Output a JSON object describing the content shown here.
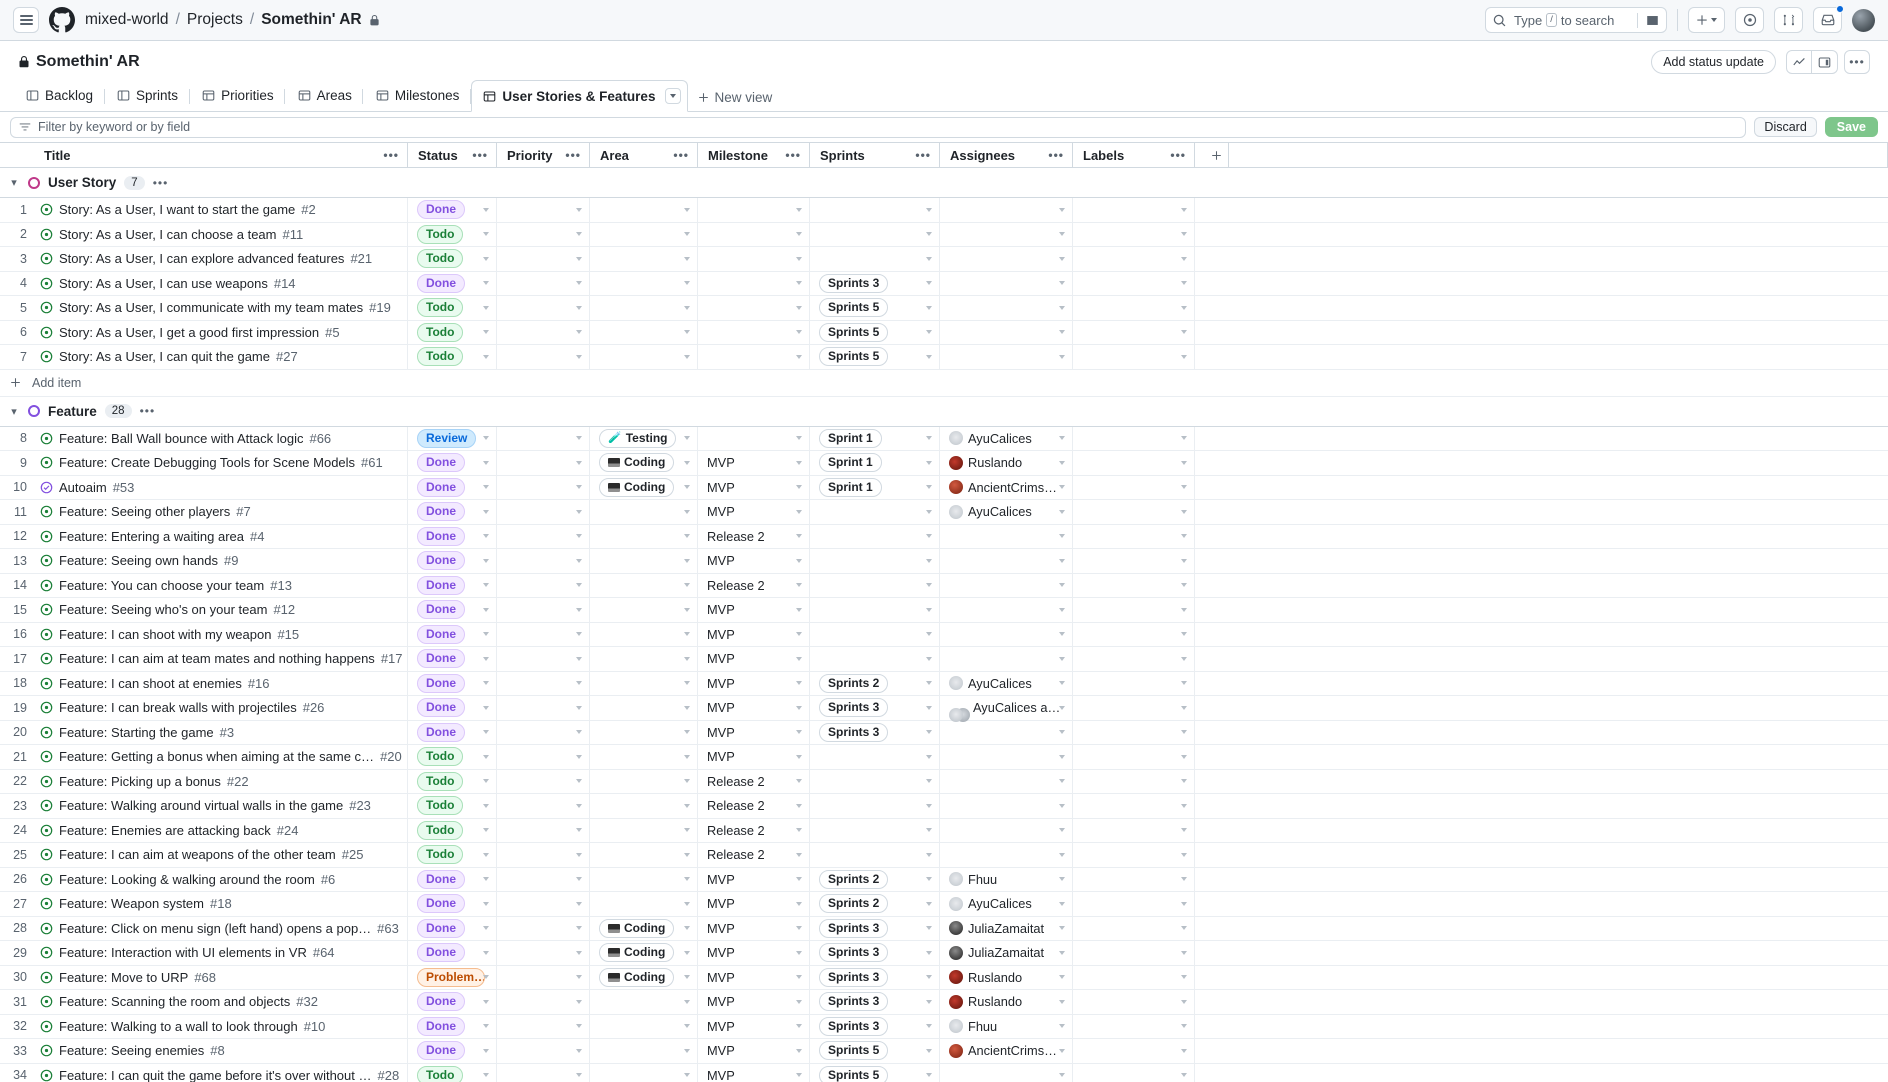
{
  "header": {
    "breadcrumb": {
      "owner": "mixed-world",
      "section": "Projects",
      "project": "Somethin' AR",
      "sep": "/"
    },
    "search": {
      "prefix": "Type",
      "key": "/",
      "suffix": "to search"
    },
    "icons": {
      "hamburger": "hamburger-icon",
      "logo": "github-logo-icon",
      "search": "search-icon",
      "terminal": "command-palette-icon",
      "plus": "plus-icon",
      "issues": "issues-icon",
      "pullrequests": "pull-requests-icon",
      "inbox": "notifications-inbox-icon",
      "avatar": "user-avatar"
    }
  },
  "project": {
    "name": "Somethin' AR",
    "visibility_icon": "lock-icon",
    "add_status_update": "Add status update",
    "insights_icon": "insights-chart-icon",
    "sidepanel_icon": "side-panel-icon",
    "more_icon": "more-options-icon"
  },
  "tabs": [
    {
      "label": "Backlog",
      "icon": "table-board-icon",
      "active": false
    },
    {
      "label": "Sprints",
      "icon": "table-board-icon",
      "active": false
    },
    {
      "label": "Priorities",
      "icon": "table-view-icon",
      "active": false
    },
    {
      "label": "Areas",
      "icon": "table-view-icon",
      "active": false
    },
    {
      "label": "Milestones",
      "icon": "table-view-icon",
      "active": false
    },
    {
      "label": "User Stories & Features",
      "icon": "table-view-icon",
      "active": true
    }
  ],
  "new_view": "New view",
  "filter": {
    "placeholder": "Filter by keyword or by field",
    "icon": "filter-icon",
    "discard_label": "Discard",
    "save_label": "Save"
  },
  "columns": [
    {
      "key": "title",
      "label": "Title"
    },
    {
      "key": "status",
      "label": "Status"
    },
    {
      "key": "priority",
      "label": "Priority"
    },
    {
      "key": "area",
      "label": "Area"
    },
    {
      "key": "milestone",
      "label": "Milestone"
    },
    {
      "key": "sprints",
      "label": "Sprints"
    },
    {
      "key": "assignees",
      "label": "Assignees"
    },
    {
      "key": "labels",
      "label": "Labels"
    }
  ],
  "add_column_label": "+",
  "groups": [
    {
      "name": "User Story",
      "count": "7",
      "color": "#bf3989",
      "add_item_label": "Add item",
      "rows": [
        {
          "n": "1",
          "title": "Story: As a User, I want to start the game",
          "num": "#2",
          "status": "Done",
          "status_kind": "done",
          "priority": "",
          "area": "",
          "area_kind": "",
          "milestone": "",
          "sprints": "",
          "assignee": "",
          "assignee_kind": "",
          "labels": ""
        },
        {
          "n": "2",
          "title": "Story: As a User, I can choose a team",
          "num": "#11",
          "status": "Todo",
          "status_kind": "todo",
          "priority": "",
          "area": "",
          "area_kind": "",
          "milestone": "",
          "sprints": "",
          "assignee": "",
          "assignee_kind": "",
          "labels": ""
        },
        {
          "n": "3",
          "title": "Story: As a User, I can explore advanced features",
          "num": "#21",
          "status": "Todo",
          "status_kind": "todo",
          "priority": "",
          "area": "",
          "area_kind": "",
          "milestone": "",
          "sprints": "",
          "assignee": "",
          "assignee_kind": "",
          "labels": ""
        },
        {
          "n": "4",
          "title": "Story: As a User, I can use weapons",
          "num": "#14",
          "status": "Done",
          "status_kind": "done",
          "priority": "",
          "area": "",
          "area_kind": "",
          "milestone": "",
          "sprints": "Sprints 3",
          "assignee": "",
          "assignee_kind": "",
          "labels": ""
        },
        {
          "n": "5",
          "title": "Story: As a User, I communicate with my team mates",
          "num": "#19",
          "status": "Todo",
          "status_kind": "todo",
          "priority": "",
          "area": "",
          "area_kind": "",
          "milestone": "",
          "sprints": "Sprints 5",
          "assignee": "",
          "assignee_kind": "",
          "labels": ""
        },
        {
          "n": "6",
          "title": "Story: As a User, I get a good first impression",
          "num": "#5",
          "status": "Todo",
          "status_kind": "todo",
          "priority": "",
          "area": "",
          "area_kind": "",
          "milestone": "",
          "sprints": "Sprints 5",
          "assignee": "",
          "assignee_kind": "",
          "labels": ""
        },
        {
          "n": "7",
          "title": "Story: As a User, I can quit the game",
          "num": "#27",
          "status": "Todo",
          "status_kind": "todo",
          "priority": "",
          "area": "",
          "area_kind": "",
          "milestone": "",
          "sprints": "Sprints 5",
          "assignee": "",
          "assignee_kind": "",
          "labels": ""
        }
      ]
    },
    {
      "name": "Feature",
      "count": "28",
      "color": "#8250df",
      "add_item_label": "",
      "rows": [
        {
          "n": "8",
          "title": "Feature: Ball Wall bounce with Attack logic",
          "num": "#66",
          "status": "Review",
          "status_kind": "review",
          "priority": "",
          "area": "Testing",
          "area_kind": "testing",
          "milestone": "",
          "sprints": "Sprint 1",
          "assignee": "AyuCalices",
          "assignee_kind": "ayu",
          "labels": ""
        },
        {
          "n": "9",
          "title": "Feature: Create Debugging Tools for Scene Models",
          "num": "#61",
          "status": "Done",
          "status_kind": "done",
          "priority": "",
          "area": "Coding",
          "area_kind": "coding",
          "milestone": "MVP",
          "sprints": "Sprint 1",
          "assignee": "Ruslando",
          "assignee_kind": "rus",
          "labels": ""
        },
        {
          "n": "10",
          "title": "Autoaim",
          "num": "#53",
          "status": "Done",
          "status_kind": "done",
          "priority": "",
          "area": "Coding",
          "area_kind": "coding",
          "milestone": "MVP",
          "sprints": "Sprint 1",
          "assignee": "AncientCrims…",
          "assignee_kind": "anc",
          "labels": ""
        },
        {
          "n": "11",
          "title": "Feature: Seeing other players",
          "num": "#7",
          "status": "Done",
          "status_kind": "done",
          "priority": "",
          "area": "",
          "area_kind": "",
          "milestone": "MVP",
          "sprints": "",
          "assignee": "AyuCalices",
          "assignee_kind": "ayu",
          "labels": ""
        },
        {
          "n": "12",
          "title": "Feature: Entering a waiting area",
          "num": "#4",
          "status": "Done",
          "status_kind": "done",
          "priority": "",
          "area": "",
          "area_kind": "",
          "milestone": "Release 2",
          "sprints": "",
          "assignee": "",
          "assignee_kind": "",
          "labels": ""
        },
        {
          "n": "13",
          "title": "Feature: Seeing own hands",
          "num": "#9",
          "status": "Done",
          "status_kind": "done",
          "priority": "",
          "area": "",
          "area_kind": "",
          "milestone": "MVP",
          "sprints": "",
          "assignee": "",
          "assignee_kind": "",
          "labels": ""
        },
        {
          "n": "14",
          "title": "Feature: You can choose your team",
          "num": "#13",
          "status": "Done",
          "status_kind": "done",
          "priority": "",
          "area": "",
          "area_kind": "",
          "milestone": "Release 2",
          "sprints": "",
          "assignee": "",
          "assignee_kind": "",
          "labels": ""
        },
        {
          "n": "15",
          "title": "Feature: Seeing who's on your team",
          "num": "#12",
          "status": "Done",
          "status_kind": "done",
          "priority": "",
          "area": "",
          "area_kind": "",
          "milestone": "MVP",
          "sprints": "",
          "assignee": "",
          "assignee_kind": "",
          "labels": ""
        },
        {
          "n": "16",
          "title": "Feature: I can shoot with my weapon",
          "num": "#15",
          "status": "Done",
          "status_kind": "done",
          "priority": "",
          "area": "",
          "area_kind": "",
          "milestone": "MVP",
          "sprints": "",
          "assignee": "",
          "assignee_kind": "",
          "labels": ""
        },
        {
          "n": "17",
          "title": "Feature: I can aim at team mates and nothing happens",
          "num": "#17",
          "status": "Done",
          "status_kind": "done",
          "priority": "",
          "area": "",
          "area_kind": "",
          "milestone": "MVP",
          "sprints": "",
          "assignee": "",
          "assignee_kind": "",
          "labels": ""
        },
        {
          "n": "18",
          "title": "Feature: I can shoot at enemies",
          "num": "#16",
          "status": "Done",
          "status_kind": "done",
          "priority": "",
          "area": "",
          "area_kind": "",
          "milestone": "MVP",
          "sprints": "Sprints 2",
          "assignee": "AyuCalices",
          "assignee_kind": "ayu",
          "labels": ""
        },
        {
          "n": "19",
          "title": "Feature: I can break walls with projectiles",
          "num": "#26",
          "status": "Done",
          "status_kind": "done",
          "priority": "",
          "area": "",
          "area_kind": "",
          "milestone": "MVP",
          "sprints": "Sprints 3",
          "assignee": "AyuCalices a…",
          "assignee_kind": "double",
          "labels": ""
        },
        {
          "n": "20",
          "title": "Feature: Starting the game",
          "num": "#3",
          "status": "Done",
          "status_kind": "done",
          "priority": "",
          "area": "",
          "area_kind": "",
          "milestone": "MVP",
          "sprints": "Sprints 3",
          "assignee": "",
          "assignee_kind": "",
          "labels": ""
        },
        {
          "n": "21",
          "title": "Feature: Getting a bonus when aiming at the same c…",
          "num": "#20",
          "status": "Todo",
          "status_kind": "todo",
          "priority": "",
          "area": "",
          "area_kind": "",
          "milestone": "MVP",
          "sprints": "",
          "assignee": "",
          "assignee_kind": "",
          "labels": ""
        },
        {
          "n": "22",
          "title": "Feature: Picking up a bonus",
          "num": "#22",
          "status": "Todo",
          "status_kind": "todo",
          "priority": "",
          "area": "",
          "area_kind": "",
          "milestone": "Release 2",
          "sprints": "",
          "assignee": "",
          "assignee_kind": "",
          "labels": ""
        },
        {
          "n": "23",
          "title": "Feature: Walking around virtual walls in the game",
          "num": "#23",
          "status": "Todo",
          "status_kind": "todo",
          "priority": "",
          "area": "",
          "area_kind": "",
          "milestone": "Release 2",
          "sprints": "",
          "assignee": "",
          "assignee_kind": "",
          "labels": ""
        },
        {
          "n": "24",
          "title": "Feature: Enemies are attacking back",
          "num": "#24",
          "status": "Todo",
          "status_kind": "todo",
          "priority": "",
          "area": "",
          "area_kind": "",
          "milestone": "Release 2",
          "sprints": "",
          "assignee": "",
          "assignee_kind": "",
          "labels": ""
        },
        {
          "n": "25",
          "title": "Feature: I can aim at weapons of the other team",
          "num": "#25",
          "status": "Todo",
          "status_kind": "todo",
          "priority": "",
          "area": "",
          "area_kind": "",
          "milestone": "Release 2",
          "sprints": "",
          "assignee": "",
          "assignee_kind": "",
          "labels": ""
        },
        {
          "n": "26",
          "title": "Feature: Looking & walking around the room",
          "num": "#6",
          "status": "Done",
          "status_kind": "done",
          "priority": "",
          "area": "",
          "area_kind": "",
          "milestone": "MVP",
          "sprints": "Sprints 2",
          "assignee": "Fhuu",
          "assignee_kind": "fhuu",
          "labels": ""
        },
        {
          "n": "27",
          "title": "Feature: Weapon system",
          "num": "#18",
          "status": "Done",
          "status_kind": "done",
          "priority": "",
          "area": "",
          "area_kind": "",
          "milestone": "MVP",
          "sprints": "Sprints 2",
          "assignee": "AyuCalices",
          "assignee_kind": "ayu",
          "labels": ""
        },
        {
          "n": "28",
          "title": "Feature: Click on menu sign (left hand) opens a pop…",
          "num": "#63",
          "status": "Done",
          "status_kind": "done",
          "priority": "",
          "area": "Coding",
          "area_kind": "coding",
          "milestone": "MVP",
          "sprints": "Sprints 3",
          "assignee": "JuliaZamaitat",
          "assignee_kind": "jul",
          "labels": ""
        },
        {
          "n": "29",
          "title": "Feature: Interaction with UI elements in VR",
          "num": "#64",
          "status": "Done",
          "status_kind": "done",
          "priority": "",
          "area": "Coding",
          "area_kind": "coding",
          "milestone": "MVP",
          "sprints": "Sprints 3",
          "assignee": "JuliaZamaitat",
          "assignee_kind": "jul",
          "labels": ""
        },
        {
          "n": "30",
          "title": "Feature: Move to URP",
          "num": "#68",
          "status": "Problem…",
          "status_kind": "problem",
          "priority": "",
          "area": "Coding",
          "area_kind": "coding",
          "milestone": "MVP",
          "sprints": "Sprints 3",
          "assignee": "Ruslando",
          "assignee_kind": "rus",
          "labels": ""
        },
        {
          "n": "31",
          "title": "Feature: Scanning the room and objects",
          "num": "#32",
          "status": "Done",
          "status_kind": "done",
          "priority": "",
          "area": "",
          "area_kind": "",
          "milestone": "MVP",
          "sprints": "Sprints 3",
          "assignee": "Ruslando",
          "assignee_kind": "rus",
          "labels": ""
        },
        {
          "n": "32",
          "title": "Feature: Walking to a wall to look through",
          "num": "#10",
          "status": "Done",
          "status_kind": "done",
          "priority": "",
          "area": "",
          "area_kind": "",
          "milestone": "MVP",
          "sprints": "Sprints 3",
          "assignee": "Fhuu",
          "assignee_kind": "fhuu",
          "labels": ""
        },
        {
          "n": "33",
          "title": "Feature: Seeing enemies",
          "num": "#8",
          "status": "Done",
          "status_kind": "done",
          "priority": "",
          "area": "",
          "area_kind": "",
          "milestone": "MVP",
          "sprints": "Sprints 5",
          "assignee": "AncientCrims…",
          "assignee_kind": "anc",
          "labels": ""
        },
        {
          "n": "34",
          "title": "Feature: I can quit the game before it's over without …",
          "num": "#28",
          "status": "Todo",
          "status_kind": "todo",
          "priority": "",
          "area": "",
          "area_kind": "",
          "milestone": "MVP",
          "sprints": "Sprints 5",
          "assignee": "",
          "assignee_kind": "",
          "labels": ""
        }
      ]
    }
  ],
  "area_badge_icons": {
    "testing": "🧪",
    "coding": "💻"
  },
  "colors": {
    "accent": "#0969da",
    "done": "#8250df",
    "todo": "#1a7f37",
    "review": "#0969da",
    "problem": "#bc4c00",
    "user_story_group": "#bf3989",
    "feature_group": "#8250df",
    "save_green": "#7ec68b"
  }
}
